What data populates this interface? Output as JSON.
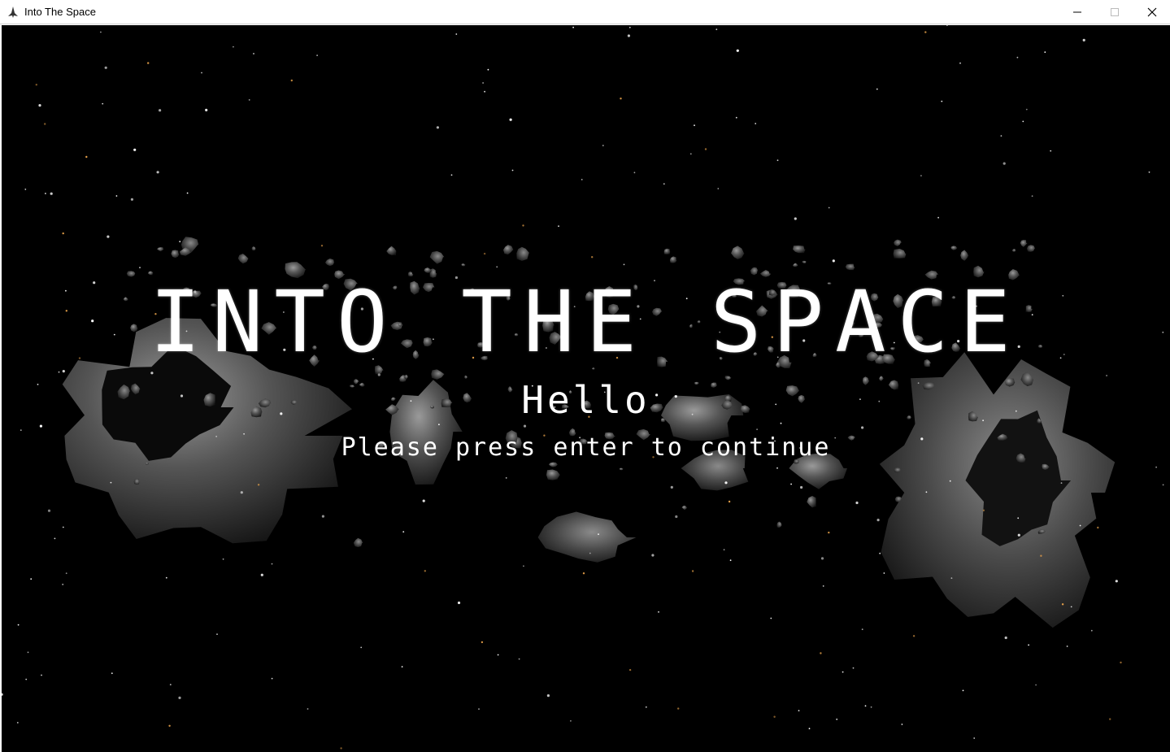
{
  "window": {
    "title": "Into The Space",
    "app_icon": "spaceship-icon",
    "controls": {
      "minimize_icon": "minimize-icon",
      "maximize_icon": "maximize-icon",
      "close_icon": "close-icon"
    }
  },
  "screen": {
    "title": "INTO THE SPACE",
    "greeting": "Hello",
    "prompt": "Please press enter to continue"
  },
  "colors": {
    "background": "#000000",
    "text": "#ffffff",
    "star": "#ffffff",
    "star_warm": "#e8a24a",
    "asteroid": "#6f6f6f"
  }
}
